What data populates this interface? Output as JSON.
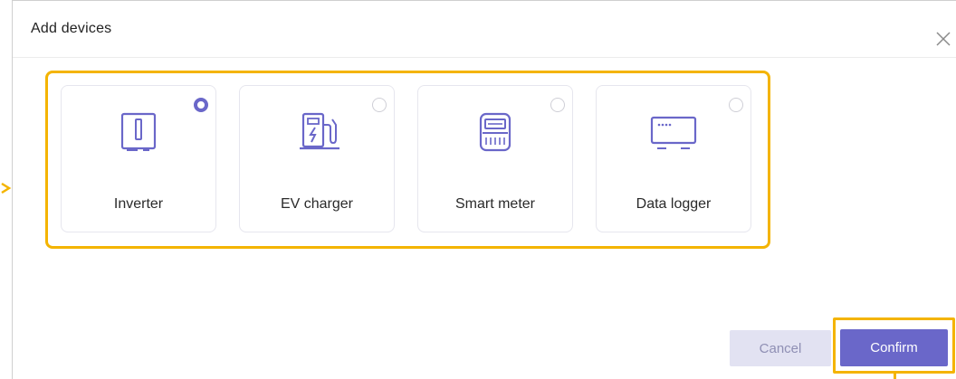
{
  "dialog": {
    "title": "Add devices",
    "close_icon": "close-icon"
  },
  "devices": [
    {
      "label": "Inverter",
      "icon": "inverter-icon",
      "selected": true
    },
    {
      "label": "EV charger",
      "icon": "ev-charger-icon",
      "selected": false
    },
    {
      "label": "Smart meter",
      "icon": "smart-meter-icon",
      "selected": false
    },
    {
      "label": "Data logger",
      "icon": "data-logger-icon",
      "selected": false
    }
  ],
  "footer": {
    "cancel_label": "Cancel",
    "confirm_label": "Confirm"
  },
  "colors": {
    "accent": "#6a67c9",
    "highlight": "#f4b400",
    "cancel_bg": "#e2e2f2"
  }
}
